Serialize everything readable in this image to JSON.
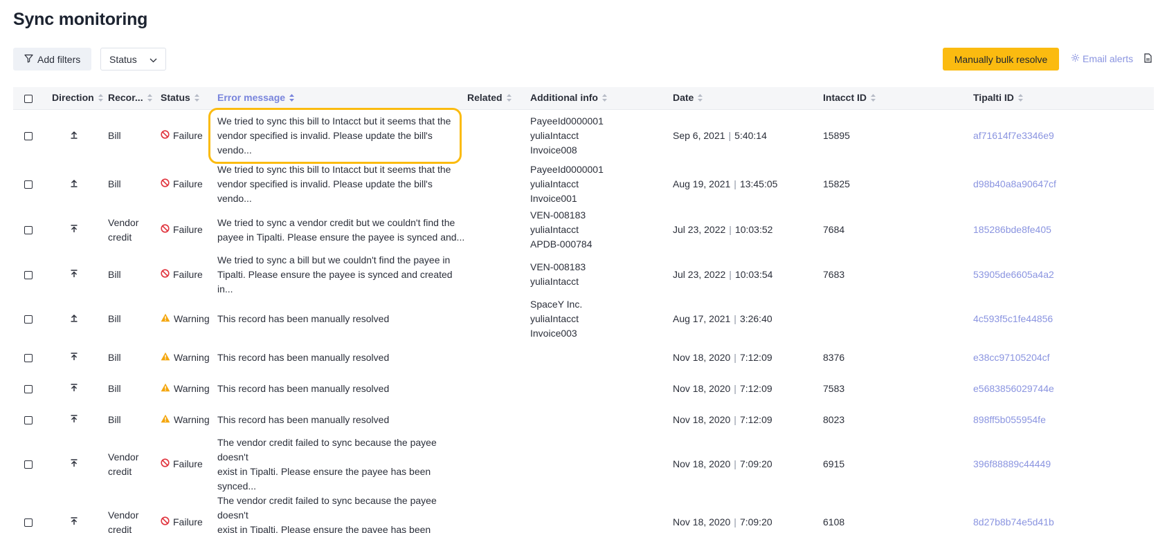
{
  "page": {
    "title": "Sync monitoring"
  },
  "toolbar": {
    "add_filters": "Add filters",
    "status_filter": "Status",
    "bulk_resolve": "Manually bulk resolve",
    "email_alerts": "Email alerts"
  },
  "columns": {
    "direction": "Direction",
    "record": "Recor...",
    "status": "Status",
    "error": "Error message",
    "related": "Related",
    "additional": "Additional info",
    "date": "Date",
    "intacct": "Intacct ID",
    "tipalti": "Tipalti ID"
  },
  "rows": [
    {
      "direction": "up",
      "record": [
        "Bill"
      ],
      "status": "Failure",
      "error": [
        "We tried to sync this bill to Intacct but it seems that the",
        "vendor specified is invalid. Please update the bill's vendo..."
      ],
      "additional": [
        "PayeeId0000001",
        "yuliaIntacct",
        "Invoice008"
      ],
      "date": "Sep 6, 2021",
      "time": "5:40:14",
      "intacct": "15895",
      "tipalti": "af71614f7e3346e9",
      "highlighted": true
    },
    {
      "direction": "up",
      "record": [
        "Bill"
      ],
      "status": "Failure",
      "error": [
        "We tried to sync this bill to Intacct but it seems that the",
        "vendor specified is invalid. Please update the bill's vendo..."
      ],
      "additional": [
        "PayeeId0000001",
        "yuliaIntacct",
        "Invoice001"
      ],
      "date": "Aug 19, 2021",
      "time": "13:45:05",
      "intacct": "15825",
      "tipalti": "d98b40a8a90647cf"
    },
    {
      "direction": "top",
      "record": [
        "Vendor",
        "credit"
      ],
      "status": "Failure",
      "error": [
        "We tried to sync a vendor credit but we couldn't find the",
        "payee in Tipalti. Please ensure the payee is synced and..."
      ],
      "additional": [
        "VEN-008183",
        "yuliaIntacct",
        "APDB-000784"
      ],
      "date": "Jul 23, 2022",
      "time": "10:03:52",
      "intacct": "7684",
      "tipalti": "185286bde8fe405"
    },
    {
      "direction": "top",
      "record": [
        "Bill"
      ],
      "status": "Failure",
      "error": [
        "We tried to sync a bill but we couldn't find the payee in",
        "Tipalti. Please ensure the payee is synced and created in..."
      ],
      "additional": [
        "VEN-008183",
        "yuliaIntacct"
      ],
      "date": "Jul 23, 2022",
      "time": "10:03:54",
      "intacct": "7683",
      "tipalti": "53905de6605a4a2"
    },
    {
      "direction": "up",
      "record": [
        "Bill"
      ],
      "status": "Warning",
      "error": [
        "This record has been manually resolved"
      ],
      "additional": [
        "SpaceY Inc.",
        "yuliaIntacct",
        "Invoice003"
      ],
      "date": "Aug 17, 2021",
      "time": "3:26:40",
      "intacct": "",
      "tipalti": "4c593f5c1fe44856"
    },
    {
      "direction": "top",
      "record": [
        "Bill"
      ],
      "status": "Warning",
      "error": [
        "This record has been manually resolved"
      ],
      "additional": [],
      "date": "Nov 18, 2020",
      "time": "7:12:09",
      "intacct": "8376",
      "tipalti": "e38cc97105204cf"
    },
    {
      "direction": "top",
      "record": [
        "Bill"
      ],
      "status": "Warning",
      "error": [
        "This record has been manually resolved"
      ],
      "additional": [],
      "date": "Nov 18, 2020",
      "time": "7:12:09",
      "intacct": "7583",
      "tipalti": "e5683856029744e"
    },
    {
      "direction": "top",
      "record": [
        "Bill"
      ],
      "status": "Warning",
      "error": [
        "This record has been manually resolved"
      ],
      "additional": [],
      "date": "Nov 18, 2020",
      "time": "7:12:09",
      "intacct": "8023",
      "tipalti": "898ff5b055954fe"
    },
    {
      "direction": "top",
      "record": [
        "Vendor",
        "credit"
      ],
      "status": "Failure",
      "error": [
        "The vendor credit failed to sync because the payee doesn't",
        "exist in Tipalti. Please ensure the payee has been synced..."
      ],
      "additional": [],
      "date": "Nov 18, 2020",
      "time": "7:09:20",
      "intacct": "6915",
      "tipalti": "396f88889c44449"
    },
    {
      "direction": "top",
      "record": [
        "Vendor",
        "credit"
      ],
      "status": "Failure",
      "error": [
        "The vendor credit failed to sync because the payee doesn't",
        "exist in Tipalti. Please ensure the payee has been synced..."
      ],
      "additional": [],
      "date": "Nov 18, 2020",
      "time": "7:09:20",
      "intacct": "6108",
      "tipalti": "8d27b8b74e5d41b"
    }
  ],
  "colors": {
    "accent": "#fbbb10",
    "link": "#8a94e0",
    "failure": "#e0323c",
    "warning": "#f4a60d"
  }
}
